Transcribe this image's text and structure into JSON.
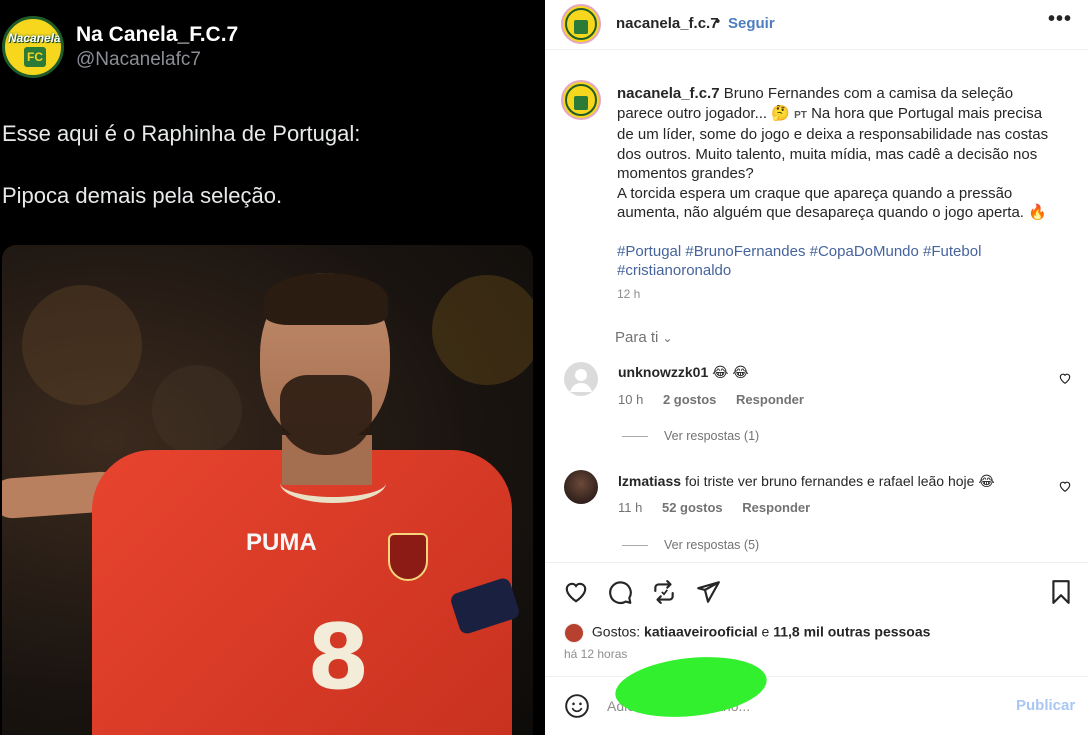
{
  "tweet": {
    "display_name": "Na Canela_F.C.7",
    "handle": "@Nacanelafc7",
    "avatar_logo_text": "Nacanela",
    "avatar_logo_fc": "FC",
    "line1": "Esse aqui é o Raphinha de Portugal:",
    "line2": "Pipoca demais pela seleção.",
    "shirt_number": "8",
    "shirt_brand": "PUMA"
  },
  "instagram": {
    "username": "nacanela_f.c.7",
    "separator": "•",
    "follow_label": "Seguir",
    "more_icon": "more-options-icon",
    "caption": {
      "user": "nacanela_f.c.7",
      "part1": "Bruno Fernandes com a camisa da seleção parece outro jogador...",
      "emoji1": "🤔",
      "flag": "PT",
      "part2": "Na hora que Portugal mais precisa de um líder, some do jogo e deixa a responsabilidade nas costas dos outros. Muito talento, muita mídia, mas cadê a decisão nos momentos grandes?",
      "part3": "A torcida espera um craque que apareça quando a pressão aumenta, não alguém que desapareça quando o jogo aperta.",
      "emoji2": "🔥",
      "hashtags": "#Portugal #BrunoFernandes #CopaDoMundo #Futebol #cristianoronaldo"
    },
    "post_time": "12 h",
    "para_ti": "Para ti",
    "comments": [
      {
        "user": "unknowzzk01",
        "text": "😂 😂",
        "time": "10 h",
        "likes": "2 gostos",
        "reply": "Responder",
        "view_replies": "Ver respostas (1)"
      },
      {
        "user": "lzmatiass",
        "text": "foi triste ver bruno fernandes e rafael leão hoje 😂",
        "time": "11 h",
        "likes": "52 gostos",
        "reply": "Responder",
        "view_replies": "Ver respostas (5)"
      }
    ],
    "likes_prefix": "Gostos:",
    "likes_user": "katiaaveirooficial",
    "likes_connector": "e",
    "likes_others": "11,8 mil outras pessoas",
    "ago": "há 12 horas",
    "comment_placeholder": "Adicionar comentário...",
    "publish_label": "Publicar",
    "colors": {
      "follow": "#4e7ec0",
      "hashtag": "#46649c",
      "publish_disabled": "#a9c7f3",
      "redaction": "#33f02f"
    }
  }
}
